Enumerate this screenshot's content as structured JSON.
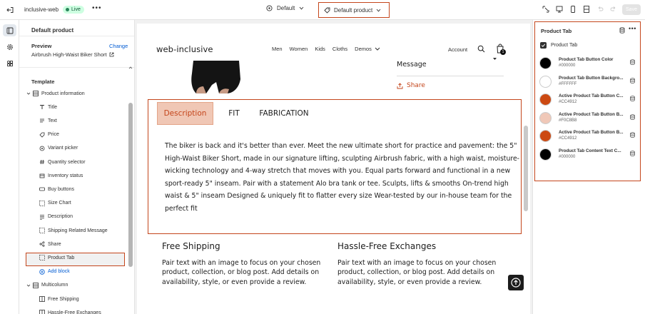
{
  "topbar": {
    "store_name": "inclusive-web",
    "live_badge": "Live",
    "more_label": "•••",
    "theme_label": "Default",
    "template_label": "Default product",
    "save_label": "Save"
  },
  "left_panel": {
    "title": "Default product",
    "preview_label": "Preview",
    "preview_change": "Change",
    "preview_value": "Airbrush High-Waist Biker Short",
    "template_label": "Template",
    "tree": [
      {
        "label": "Product information",
        "kind": "section",
        "icon": "section-icon"
      },
      {
        "label": "Title",
        "kind": "block",
        "icon": "title-icon"
      },
      {
        "label": "Text",
        "kind": "block",
        "icon": "text-icon"
      },
      {
        "label": "Price",
        "kind": "block",
        "icon": "price-tag-icon"
      },
      {
        "label": "Variant picker",
        "kind": "block",
        "icon": "variant-icon"
      },
      {
        "label": "Quantity selector",
        "kind": "block",
        "icon": "hash-icon"
      },
      {
        "label": "Inventory status",
        "kind": "block",
        "icon": "inventory-icon"
      },
      {
        "label": "Buy buttons",
        "kind": "block",
        "icon": "button-icon"
      },
      {
        "label": "Size Chart",
        "kind": "block",
        "icon": "dashed-square-icon"
      },
      {
        "label": "Description",
        "kind": "block",
        "icon": "description-icon"
      },
      {
        "label": "Shipping Related Message",
        "kind": "block",
        "icon": "dashed-square-icon"
      },
      {
        "label": "Share",
        "kind": "block",
        "icon": "share-icon"
      },
      {
        "label": "Product Tab",
        "kind": "block",
        "icon": "dashed-square-icon"
      },
      {
        "label": "Add block",
        "kind": "add",
        "icon": "add-circle-icon"
      },
      {
        "label": "Multicolumn",
        "kind": "section",
        "icon": "section-icon"
      },
      {
        "label": "Free Shipping",
        "kind": "block",
        "icon": "column-icon"
      },
      {
        "label": "Hassle-Free Exchanges",
        "kind": "block",
        "icon": "column-icon"
      }
    ]
  },
  "site": {
    "logo": "web-inclusive",
    "nav": [
      "Men",
      "Women",
      "Kids",
      "Cloths",
      "Demos"
    ],
    "account": "Account",
    "cart_count": "1",
    "message_label": "Message",
    "share_label": "Share",
    "tabs": [
      "Description",
      "FIT",
      "FABRICATION"
    ],
    "tab_content": "The biker is back and it's better than ever. Meet the new ultimate short for practice and pavement: the 5\" High-Waist Biker Short, made in our signature lifting, sculpting Airbrush fabric, with a high waist, moisture-wicking technology and 4-way stretch that moves with you. Equal parts forward and functional in a new sport-ready 5\" inseam. Pair with a statement Alo bra tank or tee. Sculpts, lifts & smooths On-trend high waist & 5\" inseam Designed & uniquely fit to flatter every size Wear-tested by our in-house team for the perfect fit",
    "columns": [
      {
        "title": "Free Shipping",
        "text": "Pair text with an image to focus on your chosen product, collection, or blog post. Add details on availability, style, or even provide a review."
      },
      {
        "title": "Hassle-Free Exchanges",
        "text": "Pair text with an image to focus on your chosen product, collection, or blog post. Add details on availability, style, or even provide a review."
      }
    ]
  },
  "right_panel": {
    "title": "Product Tab",
    "more_label": "•••",
    "checkbox_label": "Product Tab",
    "checkbox_checked": true,
    "colors": [
      {
        "name": "Product Tab Button Color",
        "hex": "#000000"
      },
      {
        "name": "Product Tab Button Backgro...",
        "hex": "#FFFFFF"
      },
      {
        "name": "Active Product Tab Button C...",
        "hex": "#CC4912"
      },
      {
        "name": "Active Product Tab Button B...",
        "hex": "#F0C8B8"
      },
      {
        "name": "Active Product Tab Button B...",
        "hex": "#CC4912"
      },
      {
        "name": "Product Tab Content Text C...",
        "hex": "#000000"
      }
    ]
  },
  "colors": {
    "accent": "#c4461c",
    "link": "#005bd3",
    "active_tab_bg": "#f0c7b5"
  }
}
